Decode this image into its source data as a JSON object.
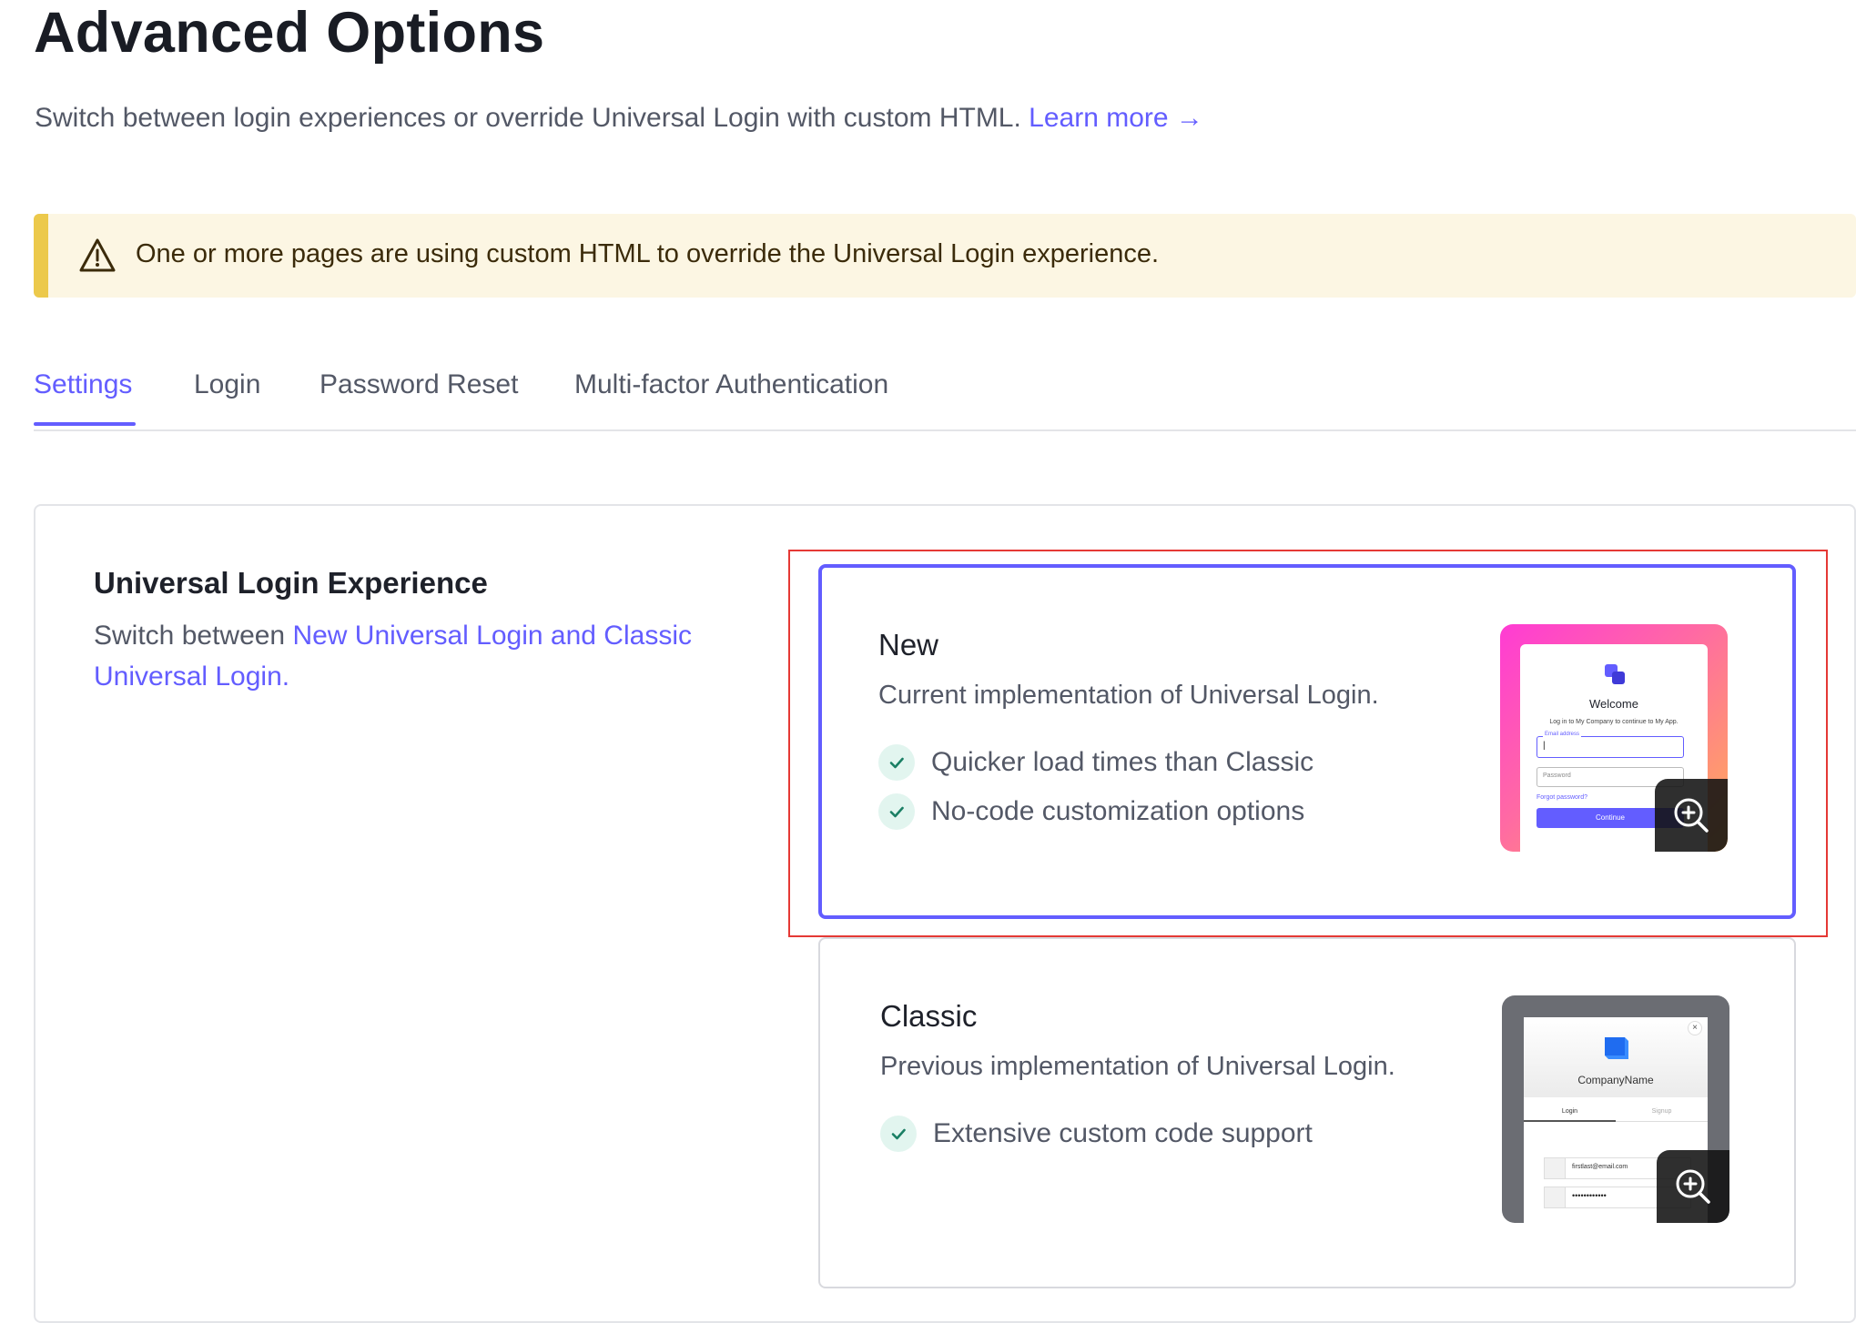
{
  "page": {
    "title": "Advanced Options",
    "subtitle": "Switch between login experiences or override Universal Login with custom HTML.",
    "learn_more": "Learn more →"
  },
  "warning": {
    "icon": "warning-triangle-icon",
    "text": "One or more pages are using custom HTML to override the Universal Login experience.",
    "bar_color": "#ecc94b",
    "bg_color": "#fcf6e3"
  },
  "tabs": [
    {
      "label": "Settings",
      "active": true
    },
    {
      "label": "Login",
      "active": false
    },
    {
      "label": "Password Reset",
      "active": false
    },
    {
      "label": "Multi-factor Authentication",
      "active": false
    }
  ],
  "section": {
    "title": "Universal Login Experience",
    "desc_prefix": "Switch between ",
    "desc_link": "New Universal Login and Classic Universal Login."
  },
  "options": {
    "new": {
      "title": "New",
      "desc": "Current implementation of Universal Login.",
      "features": [
        "Quicker load times than Classic",
        "No-code customization options"
      ],
      "selected": true,
      "preview": {
        "welcome": "Welcome",
        "tagline": "Log in to My Company to continue to My App.",
        "email_label": "Email address",
        "email_value": "|",
        "password_placeholder": "Password",
        "forgot": "Forgot password?",
        "continue": "Continue"
      }
    },
    "classic": {
      "title": "Classic",
      "desc": "Previous implementation of Universal Login.",
      "features": [
        "Extensive custom code support"
      ],
      "selected": false,
      "preview": {
        "close": "×",
        "company": "CompanyName",
        "tab_login": "Login",
        "tab_signup": "Signup",
        "email_value": "firstlast@email.com",
        "password_value": "••••••••••••"
      }
    }
  },
  "colors": {
    "accent": "#635dff",
    "check_bg": "#e2f5ef",
    "check_color": "#1a7f64",
    "highlight": "#e53935"
  }
}
